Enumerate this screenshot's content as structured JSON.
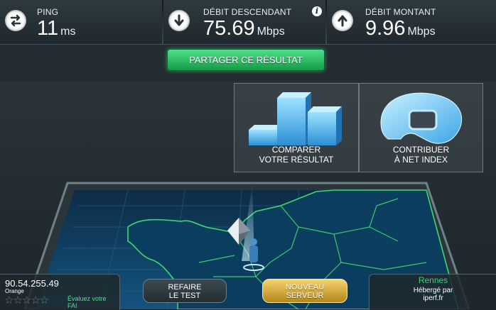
{
  "stats": {
    "ping": {
      "label": "PING",
      "value": "11",
      "unit": "ms"
    },
    "download": {
      "label": "DÉBIT DESCENDANT",
      "value": "75.69",
      "unit": "Mbps"
    },
    "upload": {
      "label": "DÉBIT MONTANT",
      "value": "9.96",
      "unit": "Mbps"
    }
  },
  "share_label": "PARTAGER CE RÉSULTAT",
  "panels": {
    "compare": {
      "line1": "COMPARER",
      "line2": "VOTRE RÉSULTAT"
    },
    "contribute": {
      "line1": "CONTRIBUER",
      "line2": "À NET INDEX"
    }
  },
  "client": {
    "ip": "90.54.255.49",
    "isp": "Orange",
    "rating": {
      "stars": 5,
      "filled": 0,
      "prompt_line1": "Évaluez votre",
      "prompt_line2": "FAI"
    }
  },
  "buttons": {
    "retest": {
      "line1": "REFAIRE",
      "line2": "LE TEST"
    },
    "new_server": {
      "line1": "NOUVEAU",
      "line2": "SERVEUR"
    }
  },
  "server": {
    "city": "Rennes",
    "hosted_by": "Hébergé par",
    "host": "iperf.fr"
  },
  "colors": {
    "accent_green": "#2fc76c",
    "gold": "#d9a93a",
    "map_blue": "#0e3a5c",
    "border_green": "#3bd16f"
  }
}
